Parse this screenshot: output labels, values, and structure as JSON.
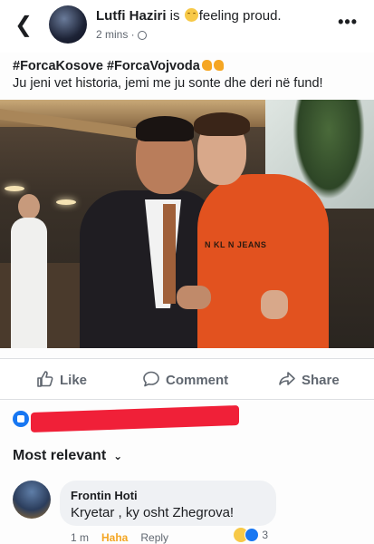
{
  "post": {
    "author": "Lutfi Haziri",
    "status_prefix": "is",
    "status_text": "feeling proud.",
    "time": "2 mins",
    "hashtags": "#ForcaKosove #ForcaVojvoda",
    "text": "Ju jeni vet historia, jemi me ju sonte dhe deri në fund!",
    "photo_caption_text": "N KL  N JEANS"
  },
  "actions": {
    "like": "Like",
    "comment": "Comment",
    "share": "Share"
  },
  "comments": {
    "sort_label": "Most relevant",
    "items": [
      {
        "author": "Frontin Hoti",
        "text": "Kryetar , ky osht Zhegrova!",
        "time": "1 m",
        "reaction_label": "Haha",
        "reply_label": "Reply",
        "reaction_count": "3"
      }
    ]
  },
  "icons": [
    "back-arrow-icon",
    "globe-icon",
    "more-icon",
    "like-icon",
    "comment-icon",
    "share-icon",
    "like-reaction-icon",
    "haha-reaction-icon",
    "chevron-down-icon"
  ],
  "colors": {
    "accent": "#1877f2",
    "redaction": "#f02038",
    "shirt": "#e2521f"
  }
}
